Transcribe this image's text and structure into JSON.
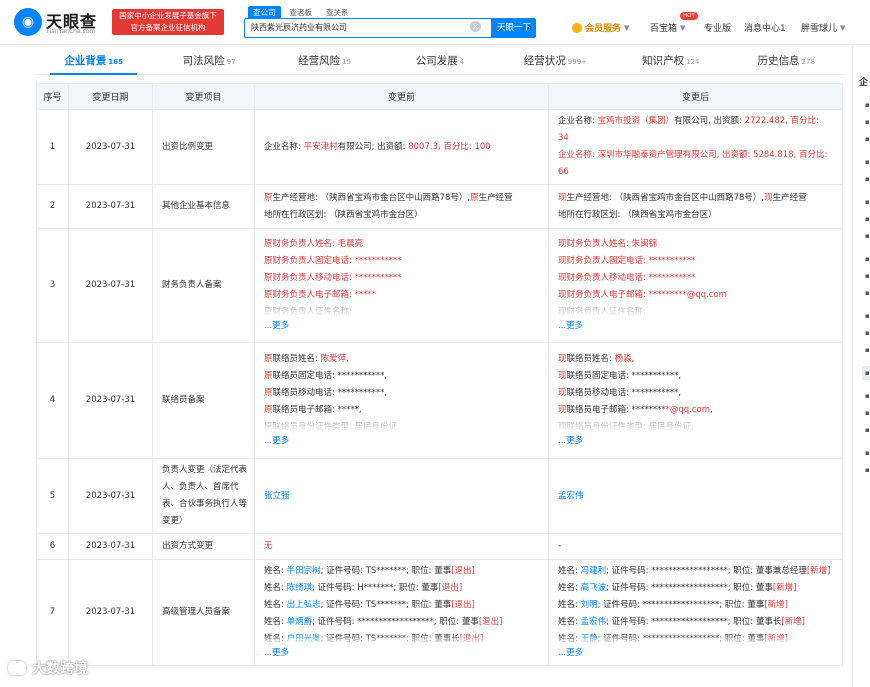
{
  "header": {
    "logo_text": "天眼查",
    "logo_domain": "TianYanCha.com",
    "gov_badge": "国家中小企业发展子基金旗下官方备案企业征信机构",
    "search_tabs": [
      "查公司",
      "查老板",
      "查关系"
    ],
    "search_value": "陕西紫光辰济药业有限公司",
    "search_button": "天眼一下",
    "vip": "会员服务",
    "baibao": "百宝箱",
    "hot_badge": "HOT",
    "pro": "专业版",
    "messages": "消息中心1",
    "user": "胖雪球儿"
  },
  "tabs": [
    {
      "label": "企业背景",
      "count": "165"
    },
    {
      "label": "司法风险",
      "count": "97"
    },
    {
      "label": "经营风险",
      "count": "15"
    },
    {
      "label": "公司发展",
      "count": "4"
    },
    {
      "label": "经营状况",
      "count": "999+"
    },
    {
      "label": "知识产权",
      "count": "124"
    },
    {
      "label": "历史信息",
      "count": "278"
    }
  ],
  "side_title": "企",
  "table": {
    "headers": [
      "序号",
      "变更日期",
      "变更项目",
      "变更前",
      "变更后"
    ],
    "more_label": "...更多",
    "rows": [
      {
        "seq": "1",
        "date": "2023-07-31",
        "item": "出资比例变更",
        "before": [
          [
            [
              "企业名称: ",
              ""
            ],
            [
              "平安津村",
              "hl"
            ],
            [
              "有限公司; 出资额: ",
              ""
            ],
            [
              "8007.3, 百分比: 100",
              "hl"
            ]
          ]
        ],
        "after": [
          [
            [
              "企业名称: ",
              ""
            ],
            [
              "宝鸡市投资（集团）",
              "hl"
            ],
            [
              "有限公司, 出资额: ",
              ""
            ],
            [
              "2722.482, 百分比:",
              "hl"
            ]
          ],
          [
            [
              "34",
              "hl"
            ]
          ],
          [
            [
              "企业名称: 深圳市华融泰资产管理有限公司, 出资额: 5284.818, 百分比:",
              "hl"
            ]
          ],
          [
            [
              "66",
              "hl"
            ]
          ]
        ]
      },
      {
        "seq": "2",
        "date": "2023-07-31",
        "item": "其他企业基本信息",
        "before": [
          [
            [
              "原",
              "hl"
            ],
            [
              "生产经营地:   （陕西省宝鸡市金台区中山西路78号）,",
              ""
            ],
            [
              "原",
              "hl"
            ],
            [
              "生产经营",
              ""
            ]
          ],
          [
            [
              "地所在行政区划:  （陕西省宝鸡市金台区）",
              ""
            ]
          ]
        ],
        "after": [
          [
            [
              "现",
              "hl"
            ],
            [
              "生产经营地:   （陕西省宝鸡市金台区中山西路78号）,",
              ""
            ],
            [
              "现",
              "hl"
            ],
            [
              "生产经营",
              ""
            ]
          ],
          [
            [
              "地所在行政区划:  （陕西省宝鸡市金台区）",
              ""
            ]
          ]
        ]
      },
      {
        "seq": "3",
        "date": "2023-07-31",
        "item": "财务负责人备案",
        "more": true,
        "before": [
          [
            [
              "原财务负责人姓名: 毛晨亮",
              "hl"
            ]
          ],
          [
            [
              "原财务负责人固定电话: ***********",
              "hl"
            ]
          ],
          [
            [
              "原财务负责人移动电话: ***********",
              "hl"
            ]
          ],
          [
            [
              "原财务负责人电子邮箱: *****",
              "hl"
            ]
          ],
          [
            [
              "原财务负责人证件名称:",
              "fade"
            ]
          ]
        ],
        "after": [
          [
            [
              "现财务负责人姓名: 朱闽锦",
              "hl"
            ]
          ],
          [
            [
              "现财务负责人固定电话: ***********",
              "hl"
            ]
          ],
          [
            [
              "现财务负责人移动电话: ***********",
              "hl"
            ]
          ],
          [
            [
              "现财务负责人电子邮箱: *********@qq.com",
              "hl"
            ]
          ],
          [
            [
              "现财务负责人证件名称:",
              "fade"
            ]
          ]
        ]
      },
      {
        "seq": "4",
        "date": "2023-07-31",
        "item": "联络员备案",
        "more": true,
        "before": [
          [
            [
              "原",
              "hl"
            ],
            [
              "联络员姓名: ",
              ""
            ],
            [
              "陈爱萍",
              "hl"
            ],
            [
              ",",
              ""
            ]
          ],
          [
            [
              "原",
              "hl"
            ],
            [
              "联络员固定电话: ***********,",
              ""
            ]
          ],
          [
            [
              "原",
              "hl"
            ],
            [
              "联络员移动电话: ***********,",
              ""
            ]
          ],
          [
            [
              "原",
              "hl"
            ],
            [
              "联络员电子邮箱: *****,",
              ""
            ]
          ],
          [
            [
              "原联络员身份证件类型: 居民身份证,",
              "fade"
            ]
          ]
        ],
        "after": [
          [
            [
              "现",
              "hl"
            ],
            [
              "联络员姓名: ",
              ""
            ],
            [
              "杨淼",
              "hl"
            ],
            [
              ",",
              ""
            ]
          ],
          [
            [
              "现",
              "hl"
            ],
            [
              "联络员固定电话: ***********,",
              ""
            ]
          ],
          [
            [
              "现",
              "hl"
            ],
            [
              "联络员移动电话: ***********,",
              ""
            ]
          ],
          [
            [
              "现",
              "hl"
            ],
            [
              "联络员电子邮箱: ********",
              ""
            ],
            [
              "*@qq.com",
              "hl"
            ],
            [
              ",",
              ""
            ]
          ],
          [
            [
              "现联络员身份证件类型: 居民身份证,",
              "fade"
            ]
          ]
        ]
      },
      {
        "seq": "5",
        "date": "2023-07-31",
        "item": "负责人变更（法定代表人、负责人、首席代表、合伙事务执行人等变更）",
        "before": [
          [
            [
              "张立强",
              "lnk"
            ]
          ]
        ],
        "after": [
          [
            [
              "孟宏伟",
              "lnk"
            ]
          ]
        ]
      },
      {
        "seq": "6",
        "date": "2023-07-31",
        "item": "出资方式变更",
        "before": [
          [
            [
              "无",
              "hl"
            ]
          ]
        ],
        "after": [
          [
            [
              "-",
              ""
            ]
          ]
        ]
      },
      {
        "seq": "7",
        "date": "2023-07-31",
        "item": "高级管理人员备案",
        "more": true,
        "before": [
          [
            [
              "姓名: ",
              ""
            ],
            [
              "半田宗树",
              "lnk"
            ],
            [
              "; 证件号码: TS*******; 职位: 董事",
              ""
            ],
            [
              "[退出]",
              "hl"
            ]
          ],
          [
            [
              "姓名: ",
              ""
            ],
            [
              "陈绮琪",
              "lnk"
            ],
            [
              "; 证件号码: H*******; 职位: 董事",
              ""
            ],
            [
              "[退出]",
              "hl"
            ]
          ],
          [
            [
              "姓名: ",
              ""
            ],
            [
              "出上弘志",
              "lnk"
            ],
            [
              "; 证件号码: TS*******; 职位: 董事",
              ""
            ],
            [
              "[退出]",
              "hl"
            ]
          ],
          [
            [
              "姓名: ",
              ""
            ],
            [
              "单炳爵",
              "lnk"
            ],
            [
              "; 证件号码: ******************; 职位: 董事",
              ""
            ],
            [
              "[退出]",
              "hl"
            ]
          ],
          [
            [
              "姓名: ",
              ""
            ],
            [
              "户田光胤",
              "lnk"
            ],
            [
              "; 证件号码: TS*******; 职位: 董事长",
              ""
            ],
            [
              "[退出]",
              "hl"
            ]
          ],
          [
            [
              "姓名: 李欣; 证件号码: ******************; 职位: 监事[退出]",
              "fade"
            ]
          ]
        ],
        "after": [
          [
            [
              "姓名: ",
              ""
            ],
            [
              "冯建利",
              "lnk"
            ],
            [
              "; 证件号码: ******************; 职位: 董事兼总经理",
              ""
            ],
            [
              "[新增]",
              "hl"
            ]
          ],
          [
            [
              "姓名: ",
              ""
            ],
            [
              "高飞波",
              "lnk"
            ],
            [
              "; 证件号码: ******************; 职位: 董事",
              ""
            ],
            [
              "[新增]",
              "hl"
            ]
          ],
          [
            [
              "姓名: ",
              ""
            ],
            [
              "刘明",
              "lnk"
            ],
            [
              "; 证件号码: ******************; 职位: 董事",
              ""
            ],
            [
              "[新增]",
              "hl"
            ]
          ],
          [
            [
              "姓名: ",
              ""
            ],
            [
              "孟宏伟",
              "lnk"
            ],
            [
              "; 证件号码: ******************; 职位: 董事长",
              ""
            ],
            [
              "[新增]",
              "hl"
            ]
          ],
          [
            [
              "姓名: ",
              ""
            ],
            [
              "王静",
              "lnk"
            ],
            [
              "; 证件号码: ******************; 职位: 董事",
              ""
            ],
            [
              "[新增]",
              "hl"
            ]
          ],
          [
            [
              "姓名: 王培军; 证件号码: ******************; 职位: 监事会主席[新增]",
              "fade"
            ]
          ]
        ]
      }
    ]
  },
  "watermark": "大数跨境"
}
